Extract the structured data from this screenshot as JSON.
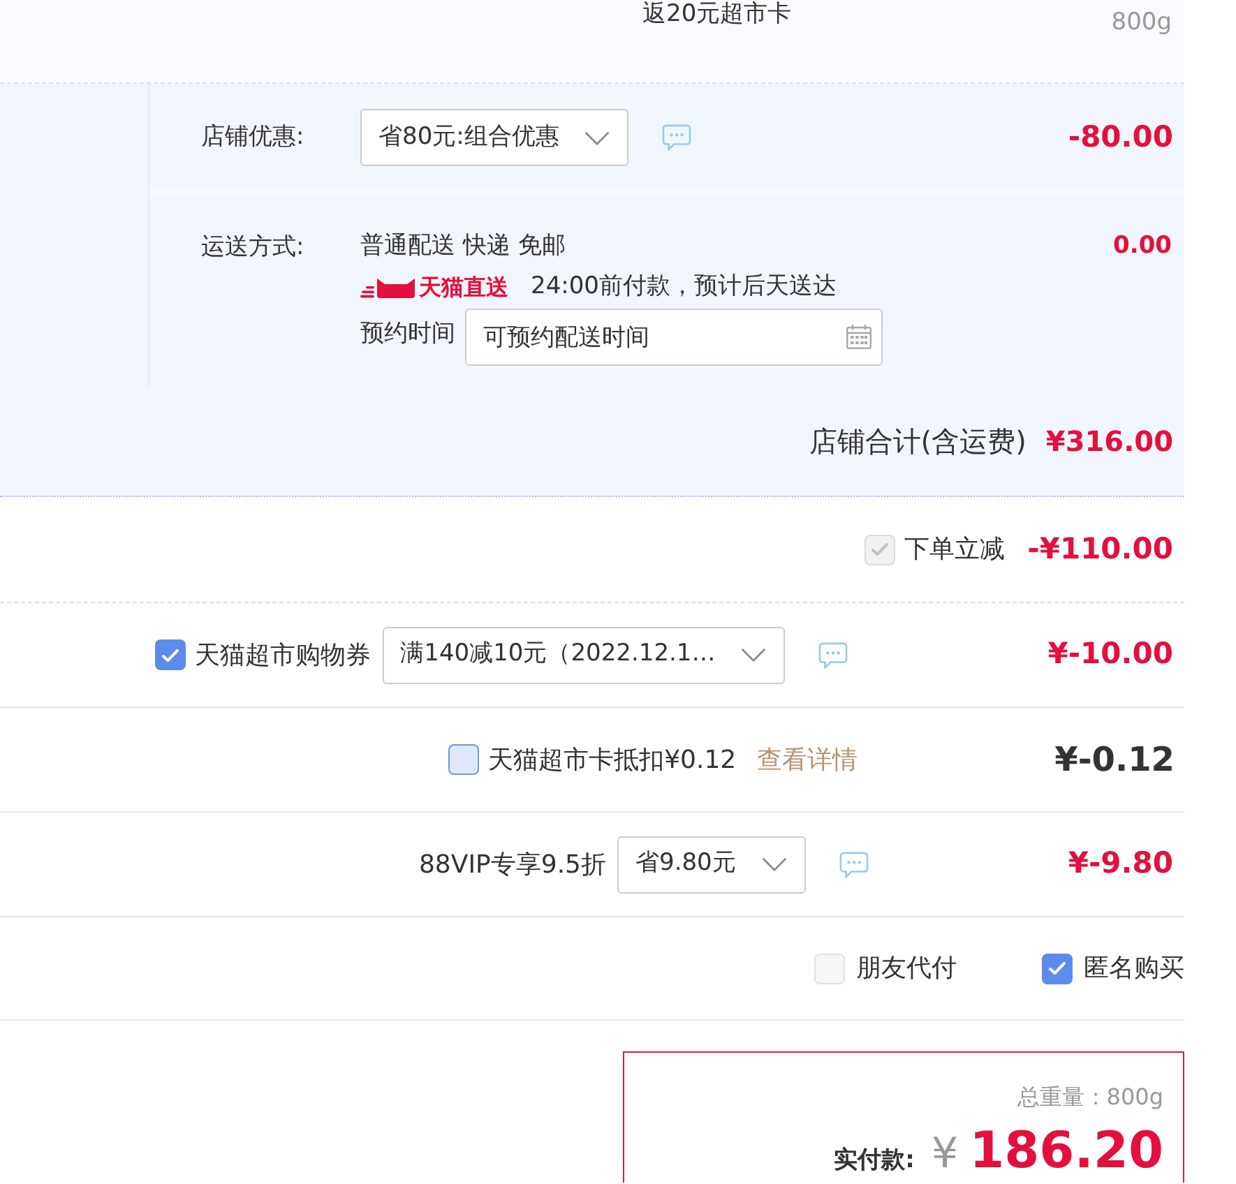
{
  "item": {
    "promo": "返20元超市卡",
    "weight": "800g"
  },
  "store": {
    "discount": {
      "label": "店铺优惠:",
      "select": "省80元:组合优惠",
      "amount": "-80.00"
    },
    "shipping": {
      "label": "运送方式:",
      "method": "普通配送 快递 免邮",
      "service": "天猫直送",
      "deadline": "24:00前付款，预计后天送达",
      "time_label": "预约时间",
      "time_field": {
        "placeholder": "可预约配送时间"
      },
      "amount": "0.00"
    },
    "total": {
      "label": "店铺合计(含运费)",
      "amount": "¥316.00"
    }
  },
  "adjustments": [
    {
      "kind": "check",
      "checkbox": {
        "checked": true,
        "disabled": true
      },
      "label": "下单立减",
      "amount": "-¥110.00"
    },
    {
      "kind": "select",
      "checkbox": {
        "checked": true,
        "disabled": false
      },
      "label": "天猫超市购物券",
      "select": "满140减10元（2022.12.1…",
      "amount": "¥-10.00"
    },
    {
      "kind": "link",
      "checkbox": {
        "checked": false,
        "disabled": false
      },
      "label": "天猫超市卡抵扣¥0.12",
      "link": "查看详情",
      "amount": "¥-0.12"
    },
    {
      "kind": "select",
      "label": "88VIP专享9.5折",
      "select": "省9.80元",
      "amount": "¥-9.80"
    }
  ],
  "options": [
    {
      "label": "朋友代付",
      "checked": false,
      "disabled": true
    },
    {
      "label": "匿名购买",
      "checked": true,
      "disabled": false
    }
  ],
  "summary": {
    "weight": "总重量：800g",
    "pay_label": "实付款:",
    "currency": "¥",
    "amount": "186.20"
  }
}
